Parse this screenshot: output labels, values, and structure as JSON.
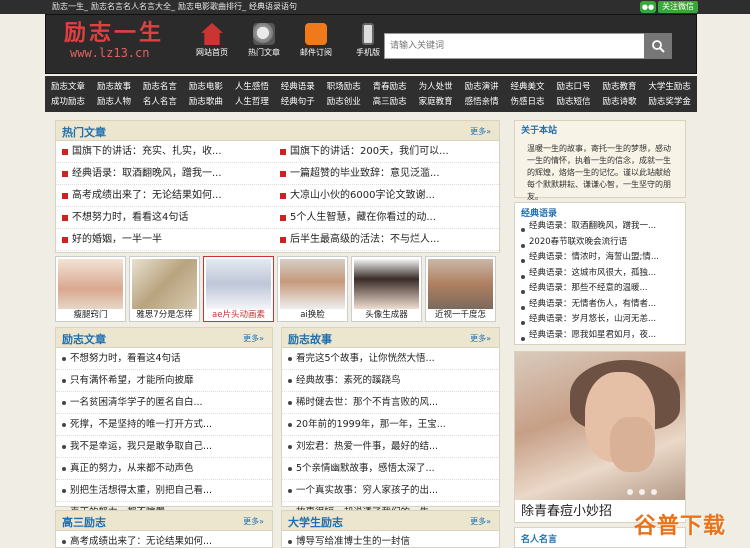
{
  "topbar": {
    "links": [
      "励志一生",
      "励志名言名人名言大全",
      "励志电影歌曲排行",
      "经典语录语句"
    ],
    "follow_label": "关注微信"
  },
  "header": {
    "logo_title": "励志一生",
    "logo_url": "www.lz13.cn",
    "icons": [
      {
        "label": "网站首页",
        "icon": "home-icon"
      },
      {
        "label": "热门文章",
        "icon": "hot-icon"
      },
      {
        "label": "邮件订阅",
        "icon": "rss-icon"
      },
      {
        "label": "手机版",
        "icon": "mobile-icon"
      }
    ],
    "search_placeholder": "请输入关键词"
  },
  "nav": {
    "row1": [
      "励志文章",
      "励志故事",
      "励志名言",
      "励志电影",
      "人生感悟",
      "经典语录",
      "职场励志",
      "青春励志",
      "为人处世",
      "励志演讲",
      "经典美文",
      "励志口号",
      "励志教育",
      "大学生励志"
    ],
    "row2": [
      "成功励志",
      "励志人物",
      "名人名言",
      "励志歌曲",
      "人生哲理",
      "经典句子",
      "励志创业",
      "高三励志",
      "家庭教育",
      "感悟亲情",
      "伤感日志",
      "励志短信",
      "励志诗歌",
      "励志奖学金"
    ]
  },
  "hot": {
    "title": "热门文章",
    "more": "更多»",
    "rows": [
      [
        "国旗下的讲话：充实、扎实，收...",
        "国旗下的讲话：200天，我们可以..."
      ],
      [
        "经典语录：取酒翻晚风，蹭我一...",
        "一篇超赞的毕业致辞：意见泛滥..."
      ],
      [
        "高考成绩出来了：无论结果如何...",
        "大凉山小伙的6000字论文致谢..."
      ],
      [
        "不想努力时，看看这4句话",
        "5个人生智慧，藏在你看过的动..."
      ],
      [
        "好的婚姻，一半一半",
        "后半生最高级的活法：不与烂人..."
      ]
    ]
  },
  "thumbs": [
    "瘦腿窍门",
    "雅思7分是怎样",
    "ae片头动画素",
    "ai换脸",
    "头像生成器",
    "近视一千度怎"
  ],
  "lz_article": {
    "title": "励志文章",
    "more": "更多»",
    "items": [
      "不想努力时，看看这4句话",
      "只有满怀希望，才能所向披靡",
      "一名贫困清华学子的匿名自白...",
      "死撑，不是坚持的唯一打开方式...",
      "我不是幸运，我只是敢争取自己...",
      "真正的努力，从来都不动声色",
      "别把生活想得太重，别把自己看...",
      "真正的努力，都不喧嚣"
    ]
  },
  "lz_story": {
    "title": "励志故事",
    "more": "更多»",
    "items": [
      "看完这5个故事，让你恍然大悟...",
      "经典故事：素死的蹊跷鸟",
      "稀时健去世：那个不肯言败的风...",
      "20年前的1999年，那一年，王宝...",
      "刘宏君：热爱一件事，最好的结...",
      "5个亲情幽默故事，感悟太深了...",
      "一个真实故事：穷人家孩子的出...",
      "故事很短，却说透了我们的一生..."
    ]
  },
  "gaosan": {
    "title": "高三励志",
    "more": "更多»",
    "items": [
      "高考成绩出来了：无论结果如何..."
    ]
  },
  "daxuesheng": {
    "title": "大学生励志",
    "more": "更多»",
    "items": [
      "博导写给准博士生的一封信"
    ]
  },
  "about": {
    "title": "关于本站",
    "text": "温暖一生的故事，寄托一生的梦想，感动一生的情怀，执着一生的信念，成就一生的辉煌，烙烙一生的记忆。谨以此站献给每个默默耕耘、谦谦心智，一生坚守的朋友。"
  },
  "classic": {
    "title": "经典语录",
    "items": [
      "经典语录：取酒翻晚风，蹭我一...",
      "2020春节联欢晚会流行语",
      "经典语录：情浓时，海誓山盟;情...",
      "经典语录：这城市风很大，孤独...",
      "经典语录：那些不经意的温暖...",
      "经典语录：无情者伤人，有情者...",
      "经典语录：岁月悠长，山河无恙...",
      "经典语录：愿我如星君如月，夜..."
    ]
  },
  "ad": {
    "caption": "除青春痘小妙招"
  },
  "famous": {
    "title": "名人名言"
  },
  "watermark": "谷普下载"
}
